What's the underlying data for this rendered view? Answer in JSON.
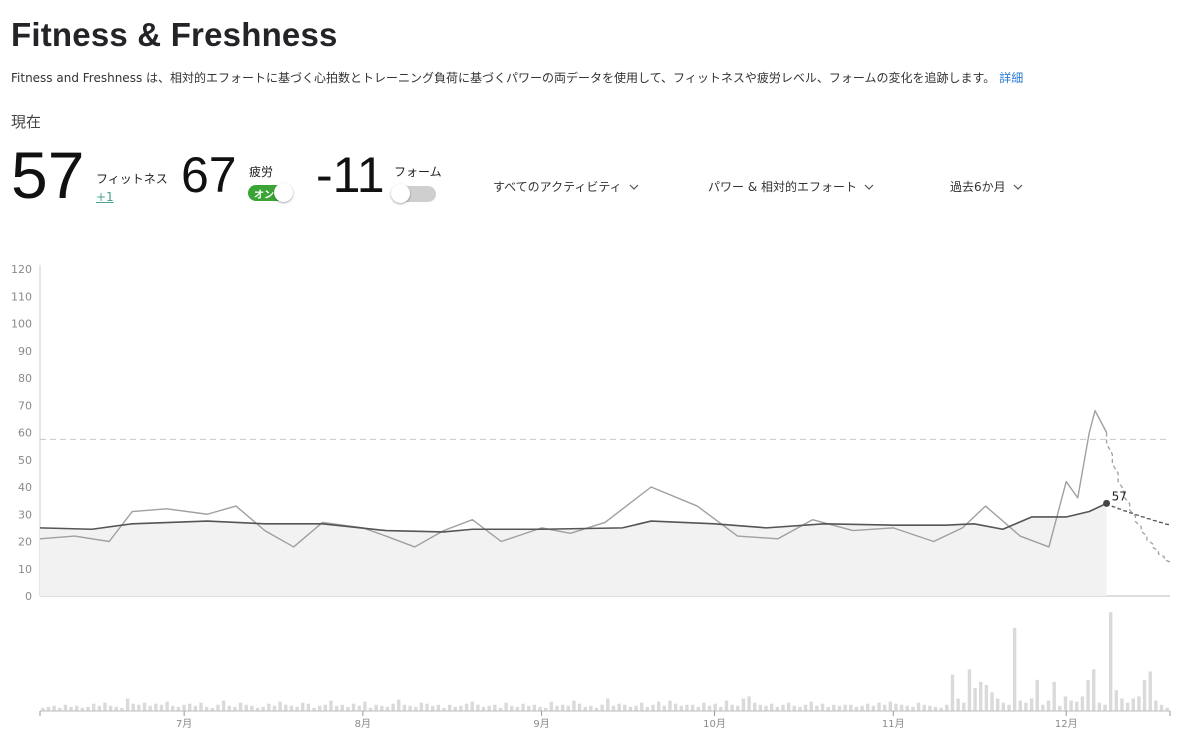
{
  "page": {
    "title": "Fitness & Freshness",
    "description": "Fitness and Freshness は、相対的エフォートに基づく心拍数とトレーニング負荷に基づくパワーの両データを使用して、フィットネスや疲労レベル、フォームの変化を追跡します。",
    "details_link": "詳細",
    "current_label": "現在"
  },
  "metrics": {
    "fitness": {
      "value": "57",
      "label": "フィットネス",
      "delta": "+1"
    },
    "fatigue": {
      "value": "67",
      "label": "疲労",
      "toggle_label": "オン",
      "toggle_on": true
    },
    "form": {
      "value": "-11",
      "label": "フォーム",
      "toggle_on": false
    }
  },
  "filters": {
    "activity": "すべてのアクティビティ",
    "data_type": "パワー & 相対的エフォート",
    "range": "過去6か月"
  },
  "colors": {
    "fitness_line": "#555555",
    "fatigue_line": "#a0a0a0",
    "area_fill": "#f2f2f2",
    "toggle_on": "#3aa536",
    "link": "#2a7bd9",
    "delta": "#4aa18c"
  },
  "chart_data": {
    "type": "line",
    "ylim": [
      0,
      120
    ],
    "yticks": [
      "0",
      "10",
      "20",
      "30",
      "40",
      "50",
      "60",
      "70",
      "80",
      "90",
      "100",
      "110",
      "120"
    ],
    "xlabels": [
      "7月",
      "8月",
      "9月",
      "10月",
      "11月",
      "12月"
    ],
    "x_start": "2024-06-06",
    "x_end": "2024-12-19",
    "today": "2024-12-08",
    "current_fitness_label": "57",
    "reference_line": 57.5,
    "series": [
      {
        "name": "フィットネス",
        "points": [
          [
            "2024-06-06",
            25
          ],
          [
            "2024-06-15",
            24.5
          ],
          [
            "2024-06-22",
            26.5
          ],
          [
            "2024-07-05",
            27.5
          ],
          [
            "2024-07-15",
            26.5
          ],
          [
            "2024-07-25",
            26.5
          ],
          [
            "2024-08-05",
            24
          ],
          [
            "2024-08-15",
            23.5
          ],
          [
            "2024-08-20",
            24.5
          ],
          [
            "2024-09-01",
            24.5
          ],
          [
            "2024-09-15",
            25
          ],
          [
            "2024-09-20",
            27.5
          ],
          [
            "2024-10-01",
            26.5
          ],
          [
            "2024-10-10",
            25
          ],
          [
            "2024-10-20",
            26.5
          ],
          [
            "2024-11-01",
            26
          ],
          [
            "2024-11-10",
            26
          ],
          [
            "2024-11-15",
            26.5
          ],
          [
            "2024-11-20",
            24.5
          ],
          [
            "2024-11-25",
            29
          ],
          [
            "2024-12-01",
            29
          ],
          [
            "2024-12-05",
            31
          ],
          [
            "2024-12-08",
            34
          ]
        ]
      },
      {
        "name": "疲労",
        "points": [
          [
            "2024-06-06",
            21
          ],
          [
            "2024-06-12",
            22
          ],
          [
            "2024-06-18",
            20
          ],
          [
            "2024-06-22",
            31
          ],
          [
            "2024-06-28",
            32
          ],
          [
            "2024-07-05",
            30
          ],
          [
            "2024-07-10",
            33
          ],
          [
            "2024-07-15",
            24
          ],
          [
            "2024-07-20",
            18
          ],
          [
            "2024-07-25",
            27
          ],
          [
            "2024-08-01",
            25
          ],
          [
            "2024-08-05",
            22
          ],
          [
            "2024-08-10",
            18
          ],
          [
            "2024-08-15",
            24
          ],
          [
            "2024-08-20",
            28
          ],
          [
            "2024-08-25",
            20
          ],
          [
            "2024-09-01",
            25
          ],
          [
            "2024-09-06",
            23
          ],
          [
            "2024-09-12",
            27
          ],
          [
            "2024-09-20",
            40
          ],
          [
            "2024-09-28",
            33
          ],
          [
            "2024-10-05",
            22
          ],
          [
            "2024-10-12",
            21
          ],
          [
            "2024-10-18",
            28
          ],
          [
            "2024-10-25",
            24
          ],
          [
            "2024-11-01",
            25
          ],
          [
            "2024-11-08",
            20
          ],
          [
            "2024-11-13",
            25
          ],
          [
            "2024-11-17",
            33
          ],
          [
            "2024-11-23",
            22
          ],
          [
            "2024-11-28",
            18
          ],
          [
            "2024-12-01",
            42
          ],
          [
            "2024-12-03",
            36
          ],
          [
            "2024-12-05",
            60
          ],
          [
            "2024-12-06",
            68
          ],
          [
            "2024-12-08",
            60
          ]
        ]
      }
    ]
  },
  "activity_bars": {
    "max": 100,
    "values": [
      3,
      4,
      5,
      3,
      6,
      4,
      5,
      3,
      4,
      7,
      5,
      8,
      5,
      4,
      3,
      12,
      7,
      6,
      8,
      5,
      7,
      6,
      9,
      5,
      4,
      6,
      7,
      5,
      8,
      4,
      3,
      6,
      10,
      5,
      4,
      8,
      6,
      5,
      3,
      4,
      7,
      5,
      9,
      6,
      5,
      4,
      8,
      7,
      3,
      5,
      6,
      10,
      5,
      6,
      4,
      7,
      5,
      9,
      3,
      6,
      5,
      4,
      7,
      11,
      6,
      5,
      4,
      8,
      7,
      5,
      6,
      3,
      6,
      4,
      5,
      7,
      9,
      6,
      4,
      5,
      6,
      3,
      8,
      5,
      4,
      7,
      5,
      6,
      4,
      3,
      9,
      5,
      6,
      5,
      10,
      7,
      4,
      5,
      3,
      6,
      12,
      5,
      7,
      6,
      4,
      5,
      8,
      4,
      6,
      9,
      5,
      10,
      7,
      5,
      6,
      6,
      4,
      8,
      5,
      7,
      4,
      10,
      6,
      5,
      12,
      14,
      8,
      6,
      5,
      7,
      4,
      6,
      8,
      5,
      4,
      6,
      9,
      5,
      7,
      4,
      6,
      5,
      6,
      6,
      4,
      5,
      7,
      5,
      8,
      6,
      9,
      7,
      6,
      5,
      4,
      8,
      6,
      5,
      4,
      3,
      6,
      35,
      12,
      8,
      40,
      22,
      28,
      25,
      18,
      12,
      8,
      6,
      80,
      10,
      8,
      12,
      30,
      6,
      10,
      28,
      5,
      14,
      10,
      9,
      14,
      30,
      40,
      8,
      6,
      95,
      20,
      12,
      8,
      12,
      14,
      30,
      38,
      10,
      6,
      3
    ]
  }
}
